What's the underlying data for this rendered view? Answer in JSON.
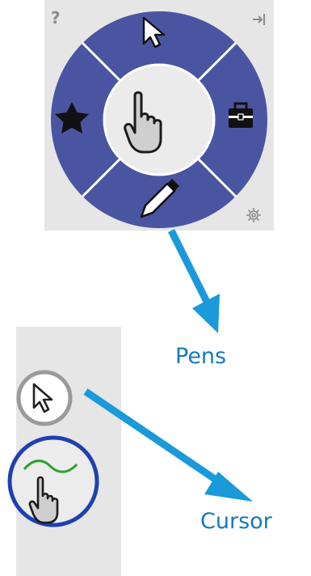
{
  "wheel": {
    "help_label": "?",
    "center_tool": "hand-pointer-icon",
    "segments": [
      "select-arrow-icon",
      "toolbox-icon",
      "pen-icon",
      "favorites-star-icon"
    ],
    "ring_color": "#4a55a2",
    "center_color": "#ebebeb"
  },
  "toolbar": {
    "tools": [
      "select-arrow-icon",
      "hand-pointer-icon"
    ],
    "active_ring_color": "#1f40b0",
    "ink_color": "#2aa12a"
  },
  "annotations": {
    "pens_label": "Pens",
    "cursor_label": "Cursor",
    "arrow_color": "#1a9ad8"
  }
}
